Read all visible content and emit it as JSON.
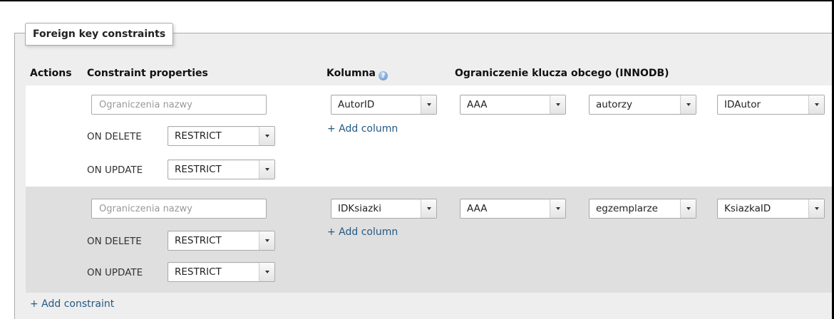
{
  "legend": "Foreign key constraints",
  "headers": {
    "actions": "Actions",
    "constraint_properties": "Constraint properties",
    "column": "Kolumna",
    "fk_constraint": "Ograniczenie klucza obcego (INNODB)"
  },
  "placeholder": "Ograniczenia nazwy",
  "on_delete_label": "ON DELETE",
  "on_update_label": "ON UPDATE",
  "add_column": "+ Add column",
  "add_constraint": "+ Add constraint",
  "rows": [
    {
      "on_delete": "RESTRICT",
      "on_update": "RESTRICT",
      "column": "AutorID",
      "database": "AAA",
      "table": "autorzy",
      "ref_column": "IDAutor"
    },
    {
      "on_delete": "RESTRICT",
      "on_update": "RESTRICT",
      "column": "IDKsiazki",
      "database": "AAA",
      "table": "egzemplarze",
      "ref_column": "KsiazkaID"
    }
  ]
}
